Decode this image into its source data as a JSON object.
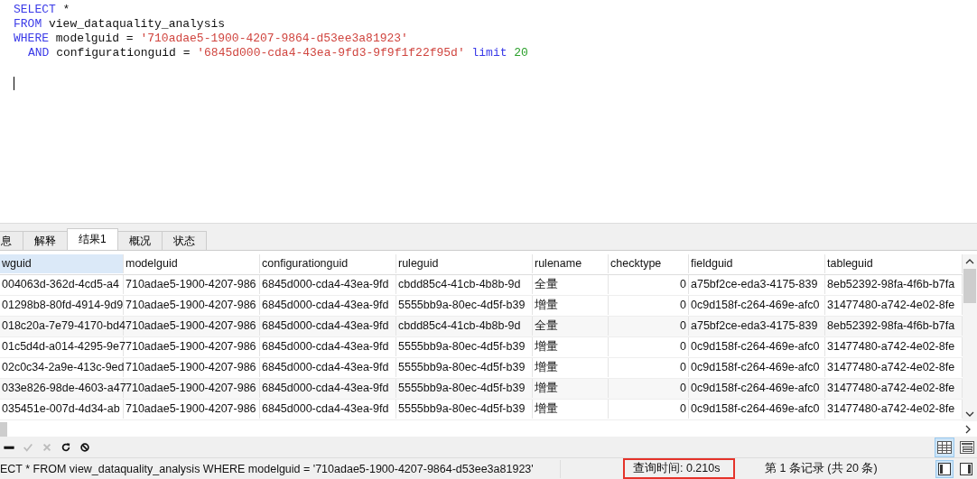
{
  "editor": {
    "lines": [
      {
        "indent": false,
        "tokens": [
          {
            "text": "SELECT",
            "kind": "keyword"
          },
          {
            "text": "*",
            "kind": "plain"
          }
        ]
      },
      {
        "indent": false,
        "tokens": [
          {
            "text": "FROM",
            "kind": "keyword"
          },
          {
            "text": "view_dataquality_analysis",
            "kind": "plain"
          }
        ]
      },
      {
        "indent": false,
        "tokens": [
          {
            "text": "WHERE",
            "kind": "keyword"
          },
          {
            "text": "modelguid",
            "kind": "plain"
          },
          {
            "text": "=",
            "kind": "plain"
          },
          {
            "text": "'710adae5-1900-4207-9864-d53ee3a81923'",
            "kind": "string"
          }
        ]
      },
      {
        "indent": true,
        "tokens": [
          {
            "text": "AND",
            "kind": "keyword"
          },
          {
            "text": "configurationguid",
            "kind": "plain"
          },
          {
            "text": "=",
            "kind": "plain"
          },
          {
            "text": "'6845d000-cda4-43ea-9fd3-9f9f1f22f95d'",
            "kind": "string"
          },
          {
            "text": "limit",
            "kind": "keyword"
          },
          {
            "text": "20",
            "kind": "number"
          }
        ]
      }
    ]
  },
  "tabs": [
    {
      "label": "息",
      "selected": false
    },
    {
      "label": "解释",
      "selected": false
    },
    {
      "label": "结果1",
      "selected": true
    },
    {
      "label": "概况",
      "selected": false
    },
    {
      "label": "状态",
      "selected": false
    }
  ],
  "table": {
    "columns": [
      {
        "label": "wguid",
        "selected": true
      },
      {
        "label": "modelguid",
        "selected": false
      },
      {
        "label": "configurationguid",
        "selected": false
      },
      {
        "label": "ruleguid",
        "selected": false
      },
      {
        "label": "rulename",
        "selected": false
      },
      {
        "label": "checktype",
        "selected": false
      },
      {
        "label": "fieldguid",
        "selected": false
      },
      {
        "label": "tableguid",
        "selected": false
      }
    ],
    "rows": [
      [
        "004063d-362d-4cd5-a4",
        "710adae5-1900-4207-986",
        "6845d000-cda4-43ea-9fd",
        "cbdd85c4-41cb-4b8b-9d",
        "全量",
        "0",
        "a75bf2ce-eda3-4175-839",
        "8eb52392-98fa-4f6b-b7fa"
      ],
      [
        "01298b8-80fd-4914-9d9",
        "710adae5-1900-4207-986",
        "6845d000-cda4-43ea-9fd",
        "5555bb9a-80ec-4d5f-b39",
        "增量",
        "0",
        "0c9d158f-c264-469e-afc0",
        "31477480-a742-4e02-8fe"
      ],
      [
        "018c20a-7e79-4170-bd4",
        "710adae5-1900-4207-986",
        "6845d000-cda4-43ea-9fd",
        "cbdd85c4-41cb-4b8b-9d",
        "全量",
        "0",
        "a75bf2ce-eda3-4175-839",
        "8eb52392-98fa-4f6b-b7fa"
      ],
      [
        "01c5d4d-a014-4295-9e7",
        "710adae5-1900-4207-986",
        "6845d000-cda4-43ea-9fd",
        "5555bb9a-80ec-4d5f-b39",
        "增量",
        "0",
        "0c9d158f-c264-469e-afc0",
        "31477480-a742-4e02-8fe"
      ],
      [
        "02c0c34-2a9e-413c-9ed",
        "710adae5-1900-4207-986",
        "6845d000-cda4-43ea-9fd",
        "5555bb9a-80ec-4d5f-b39",
        "增量",
        "0",
        "0c9d158f-c264-469e-afc0",
        "31477480-a742-4e02-8fe"
      ],
      [
        "033e826-98de-4603-a47",
        "710adae5-1900-4207-986",
        "6845d000-cda4-43ea-9fd",
        "5555bb9a-80ec-4d5f-b39",
        "增量",
        "0",
        "0c9d158f-c264-469e-afc0",
        "31477480-a742-4e02-8fe"
      ],
      [
        "035451e-007d-4d34-ab",
        "710adae5-1900-4207-986",
        "6845d000-cda4-43ea-9fd",
        "5555bb9a-80ec-4d5f-b39",
        "增量",
        "0",
        "0c9d158f-c264-469e-afc0",
        "31477480-a742-4e02-8fe"
      ]
    ]
  },
  "toolbar": [
    {
      "kind": "delete",
      "disabled": false
    },
    {
      "kind": "apply",
      "disabled": true
    },
    {
      "kind": "discard",
      "disabled": true
    },
    {
      "kind": "refresh",
      "disabled": false
    },
    {
      "kind": "stop",
      "disabled": false
    }
  ],
  "view_switch": [
    {
      "kind": "grid",
      "selected": true
    },
    {
      "kind": "form",
      "selected": false
    }
  ],
  "status_bar": {
    "query": "ECT * FROM view_dataquality_analysis WHERE modelguid = '710adae5-1900-4207-9864-d53ee3a81923'",
    "query_time": "查询时间: 0.210s",
    "query_time_highlighted": true,
    "record": "第 1 条记录 (共 20 条)",
    "panels": [
      {
        "kind": "left",
        "selected": true
      },
      {
        "kind": "right",
        "selected": false
      }
    ]
  }
}
